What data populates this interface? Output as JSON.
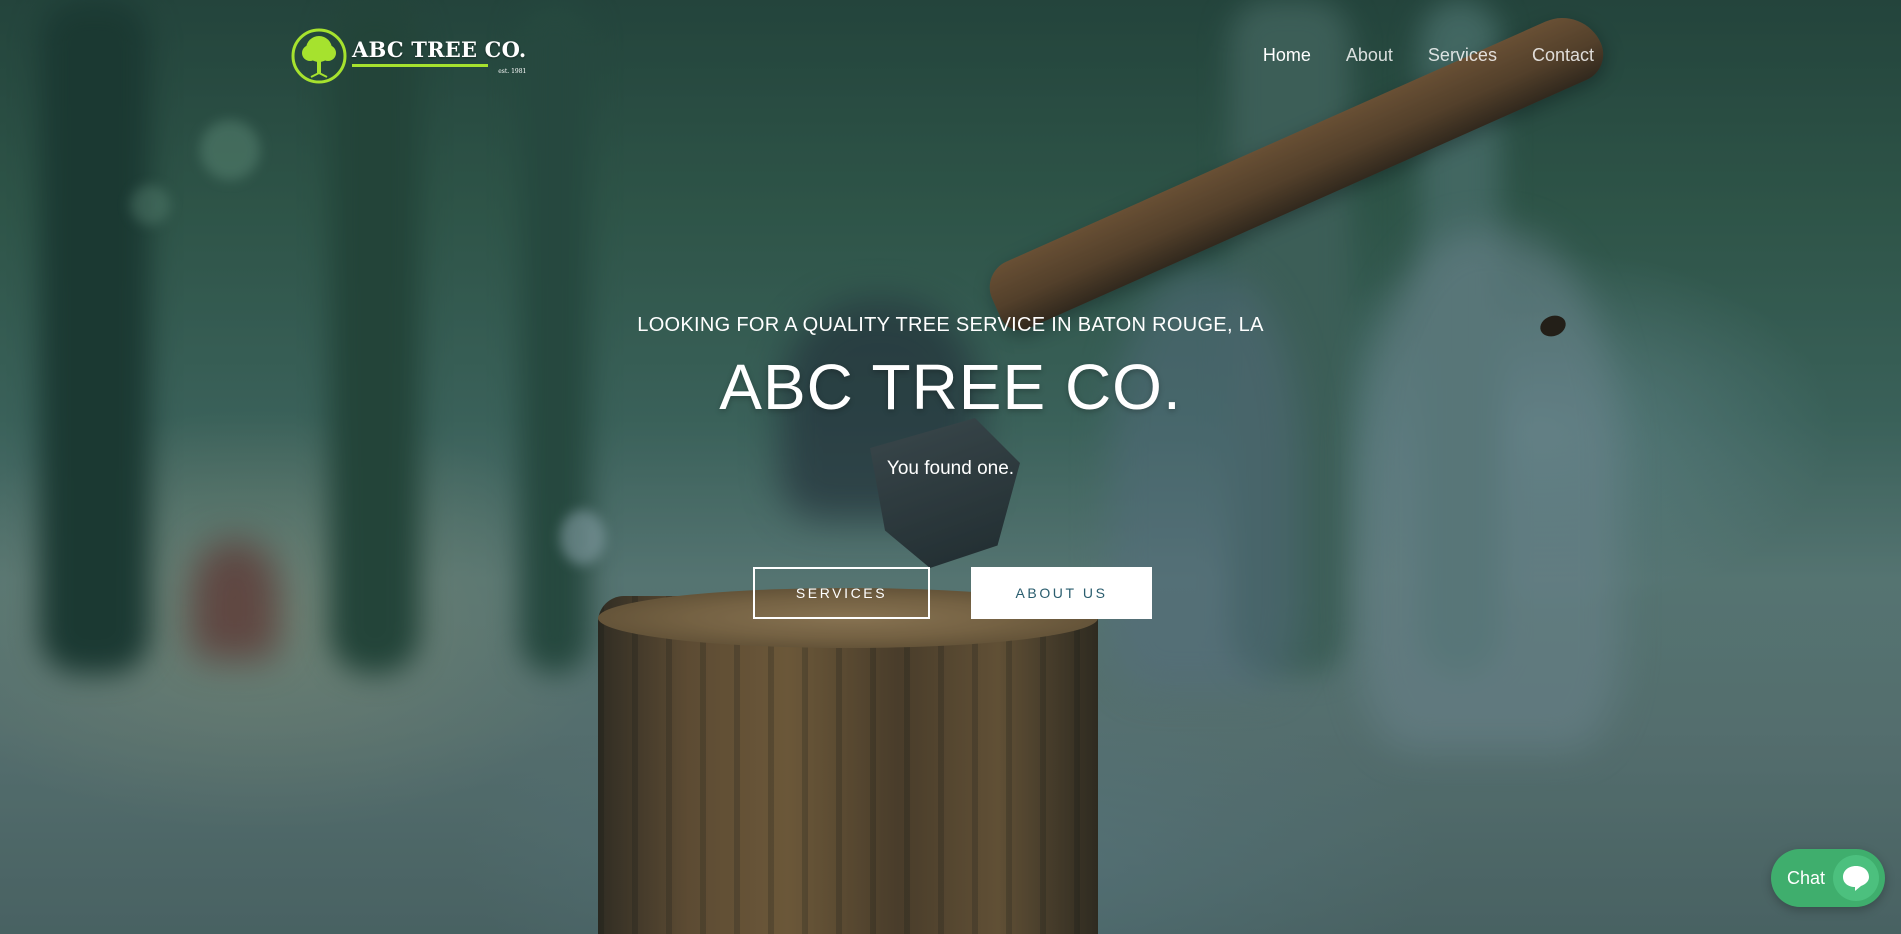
{
  "header": {
    "logo": {
      "name": "ABC TREE CO.",
      "est": "est. 1981",
      "accent_color": "#a6e22e"
    },
    "nav": [
      {
        "label": "Home",
        "active": true
      },
      {
        "label": "About",
        "active": false
      },
      {
        "label": "Services",
        "active": false
      },
      {
        "label": "Contact",
        "active": false
      }
    ]
  },
  "hero": {
    "eyebrow": "LOOKING FOR A QUALITY TREE SERVICE IN BATON ROUGE, LA",
    "title": "ABC TREE CO.",
    "tagline": "You found one.",
    "buttons": {
      "services": "SERVICES",
      "about": "ABOUT US"
    }
  },
  "chat": {
    "label": "Chat",
    "icon": "chat-bubble-icon",
    "color": "#3fae6d"
  }
}
